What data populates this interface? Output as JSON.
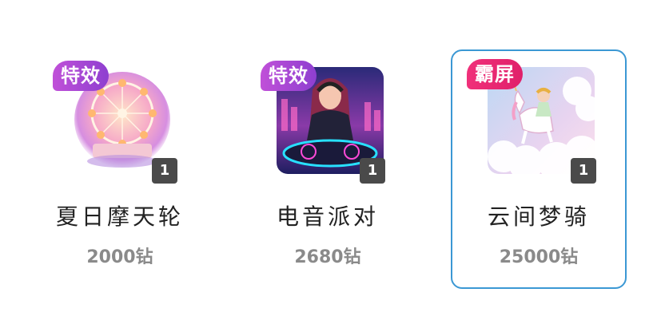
{
  "gifts": [
    {
      "tag": "特效",
      "tag_color": "#a848d4",
      "count": "1",
      "name": "夏日摩天轮",
      "price": "2000钻",
      "icon": "ferris-wheel-image",
      "selected": false
    },
    {
      "tag": "特效",
      "tag_color": "#a848d4",
      "count": "1",
      "name": "电音派对",
      "price": "2680钻",
      "icon": "dj-party-image",
      "selected": false
    },
    {
      "tag": "霸屏",
      "tag_color": "#ec2a74",
      "count": "1",
      "name": "云间梦骑",
      "price": "25000钻",
      "icon": "cloud-unicorn-image",
      "selected": true
    }
  ]
}
